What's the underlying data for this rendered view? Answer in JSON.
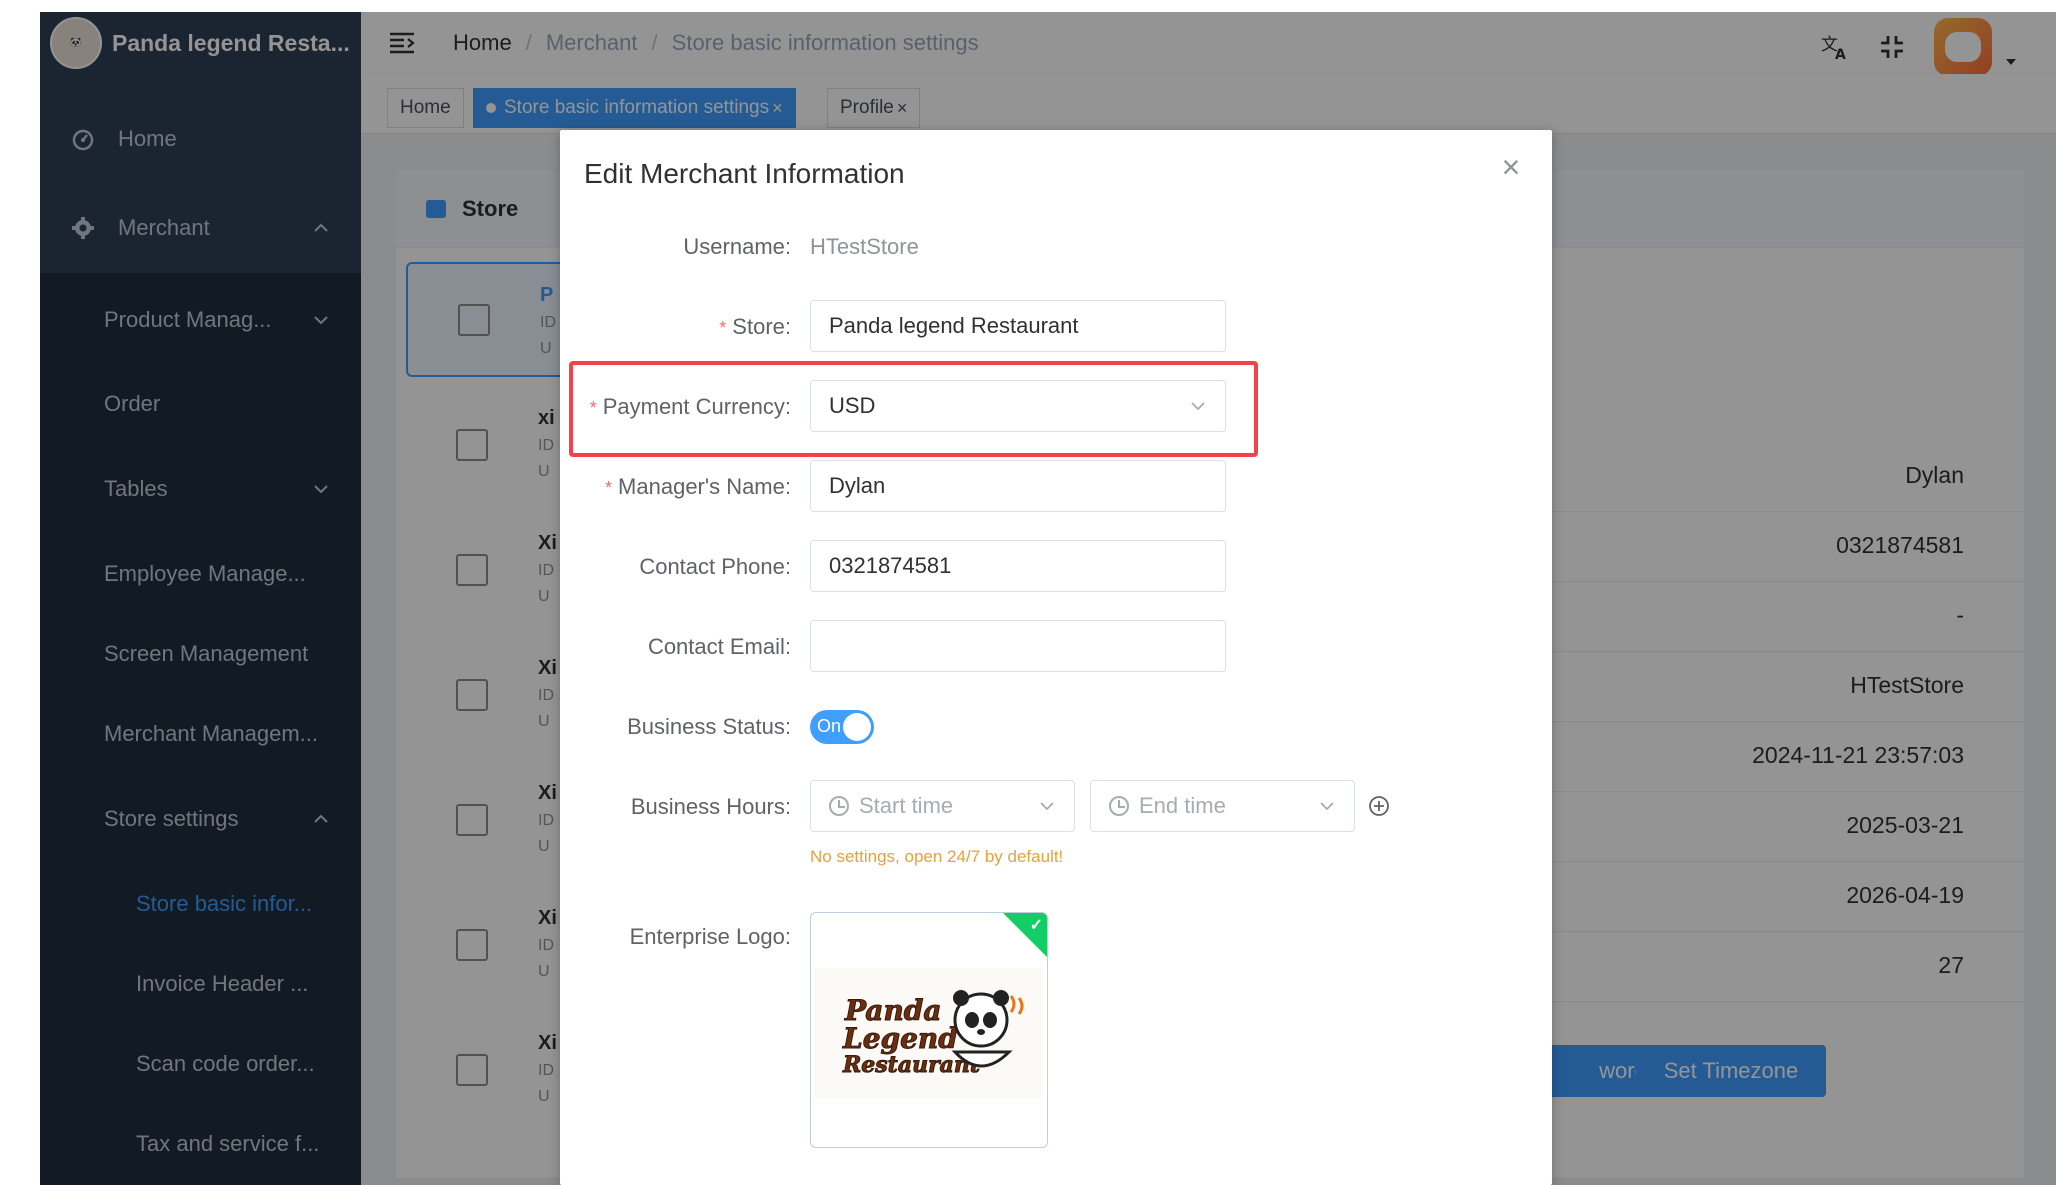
{
  "app": {
    "title": "Panda legend Resta..."
  },
  "sidebar": {
    "items": [
      {
        "label": "Home",
        "icon": "dashboard-icon"
      },
      {
        "label": "Merchant",
        "icon": "gear-icon"
      },
      {
        "label": "Product Manag..."
      },
      {
        "label": "Order"
      },
      {
        "label": "Tables"
      },
      {
        "label": "Employee Manage..."
      },
      {
        "label": "Screen Management"
      },
      {
        "label": "Merchant Managem..."
      },
      {
        "label": "Store settings"
      },
      {
        "label": "Store basic infor..."
      },
      {
        "label": "Invoice Header ..."
      },
      {
        "label": "Scan code order..."
      },
      {
        "label": "Tax and service f..."
      }
    ]
  },
  "breadcrumb": {
    "home": "Home",
    "merchant": "Merchant",
    "current": "Store basic information settings",
    "sep": "/"
  },
  "tags": [
    {
      "label": "Home"
    },
    {
      "label": "Store basic information settings",
      "close": "×"
    },
    {
      "label": "Profile",
      "close": "×"
    }
  ],
  "background": {
    "card_title": "Store",
    "store_list": [
      {
        "letter": "P",
        "l1": "ID",
        "l2": "U"
      },
      {
        "letter": "xi",
        "l1": "ID",
        "l2": "U"
      },
      {
        "letter": "Xi",
        "l1": "ID",
        "l2": "U"
      },
      {
        "letter": "Xi",
        "l1": "ID",
        "l2": "U"
      },
      {
        "letter": "Xi",
        "l1": "ID",
        "l2": "U"
      },
      {
        "letter": "Xi",
        "l1": "ID",
        "l2": "U"
      },
      {
        "letter": "Xi",
        "l1": "ID",
        "l2": "U"
      }
    ],
    "values": [
      "Dylan",
      "0321874581",
      "-",
      "HTestStore",
      "2024-11-21 23:57:03",
      "2025-03-21",
      "2026-04-19",
      "27"
    ],
    "buttons": {
      "password_partial": "word",
      "set_timezone": "Set Timezone"
    }
  },
  "dialog": {
    "title": "Edit Merchant Information",
    "close": "×",
    "fields": {
      "username": {
        "label": "Username:",
        "value": "HTestStore"
      },
      "store": {
        "label": "Store:",
        "value": "Panda legend Restaurant",
        "required": "*"
      },
      "payment_currency": {
        "label": "Payment Currency:",
        "value": "USD",
        "required": "*"
      },
      "manager_name": {
        "label": "Manager's Name:",
        "value": "Dylan",
        "required": "*"
      },
      "contact_phone": {
        "label": "Contact Phone:",
        "value": "0321874581"
      },
      "contact_email": {
        "label": "Contact Email:",
        "value": ""
      },
      "business_status": {
        "label": "Business Status:",
        "value": "On"
      },
      "business_hours": {
        "label": "Business Hours:",
        "start_placeholder": "Start time",
        "end_placeholder": "End time",
        "hint": "No settings, open 24/7 by default!"
      },
      "enterprise_logo": {
        "label": "Enterprise Logo:"
      }
    }
  },
  "colors": {
    "primary": "#409eff",
    "sidebar": "#304156",
    "highlight": "#f5424a",
    "warning": "#e6a23c",
    "success": "#13ce66"
  }
}
